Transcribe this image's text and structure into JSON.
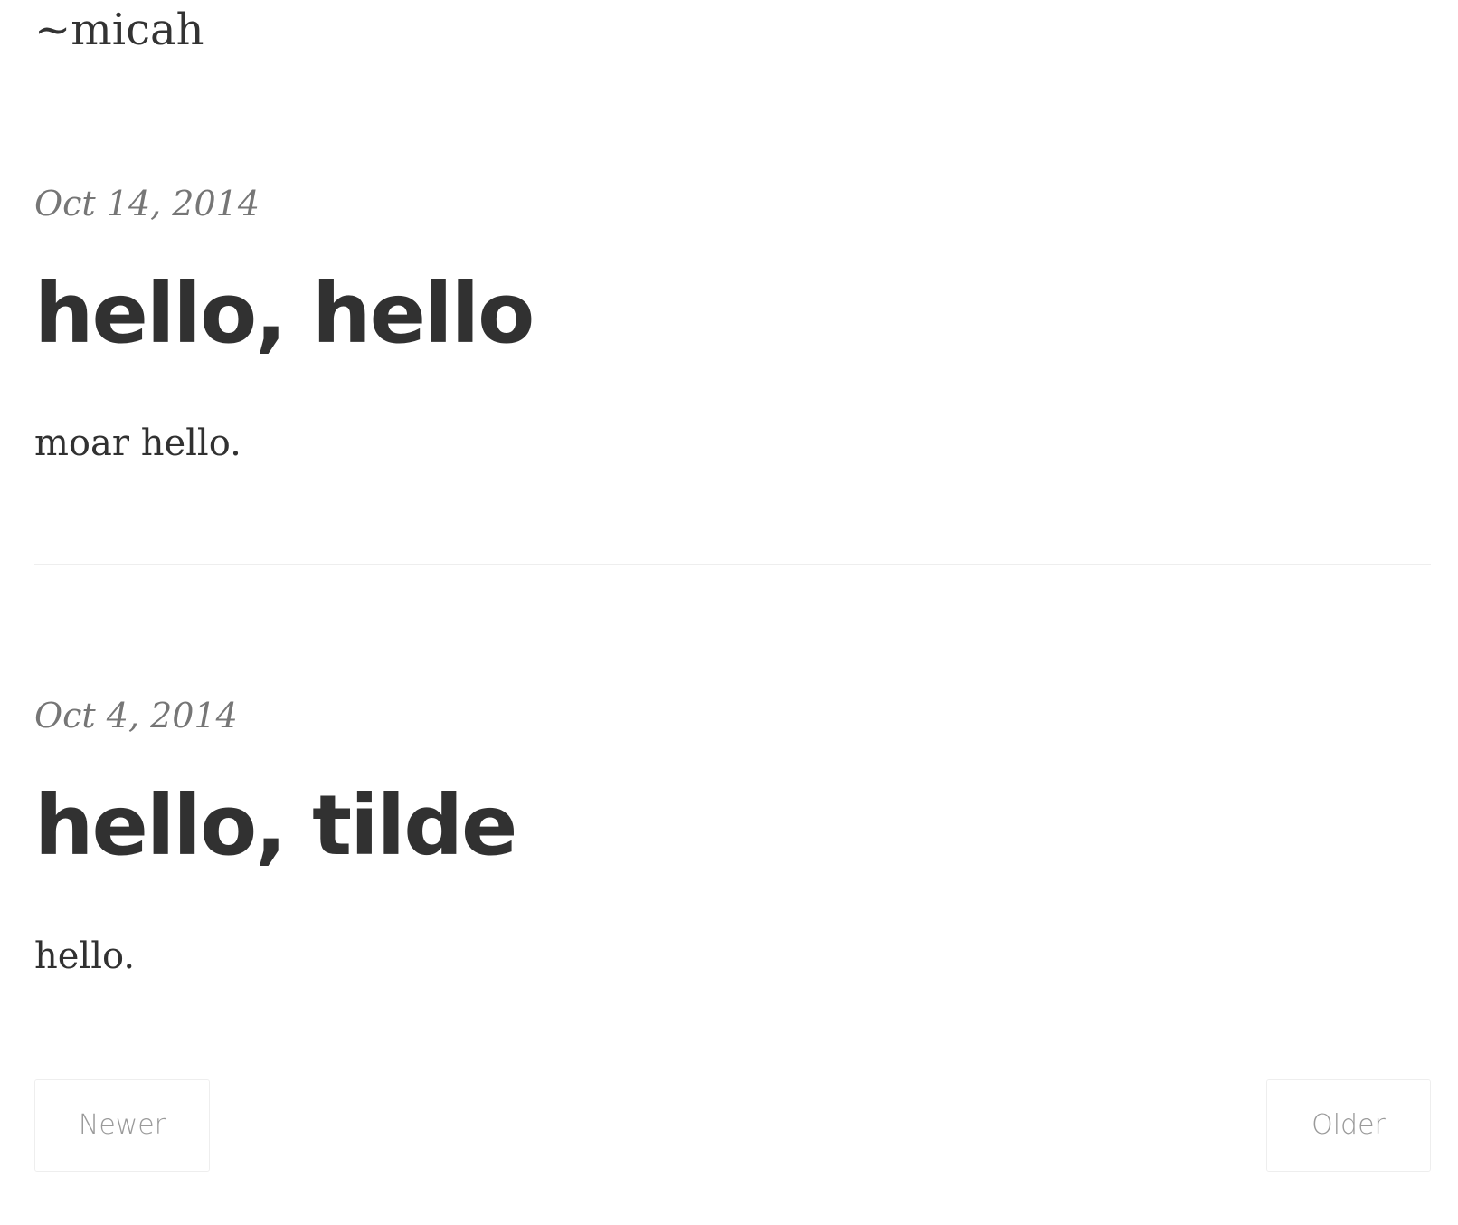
{
  "site": {
    "title": "~micah"
  },
  "posts": [
    {
      "date": "Oct 14, 2014",
      "title": "hello, hello",
      "body": "moar hello."
    },
    {
      "date": "Oct 4, 2014",
      "title": "hello, tilde",
      "body": "hello."
    }
  ],
  "pagination": {
    "newer_label": "Newer",
    "older_label": "Older"
  }
}
